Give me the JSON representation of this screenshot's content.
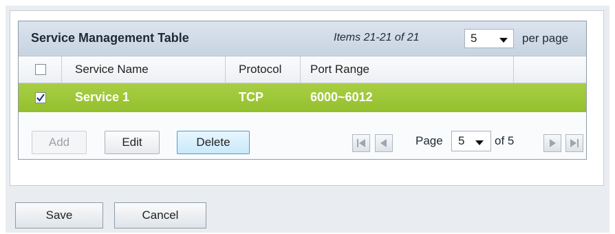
{
  "table": {
    "title": "Service Management Table",
    "items_text": "Items 21-21 of 21",
    "per_page_value": "5",
    "per_page_label": "per page",
    "columns": [
      "Service Name",
      "Protocol",
      "Port Range"
    ],
    "rows": [
      {
        "checked": true,
        "service_name": "Service 1",
        "protocol": "TCP",
        "port_range": "6000~6012"
      }
    ]
  },
  "toolbar": {
    "add_label": "Add",
    "edit_label": "Edit",
    "delete_label": "Delete"
  },
  "pagination": {
    "page_label": "Page",
    "page_value": "5",
    "of_label": "of 5"
  },
  "footer_buttons": {
    "save_label": "Save",
    "cancel_label": "Cancel"
  },
  "colors": {
    "selected_row": "#9bc63a",
    "delete_highlight": "#4a9fcf"
  }
}
